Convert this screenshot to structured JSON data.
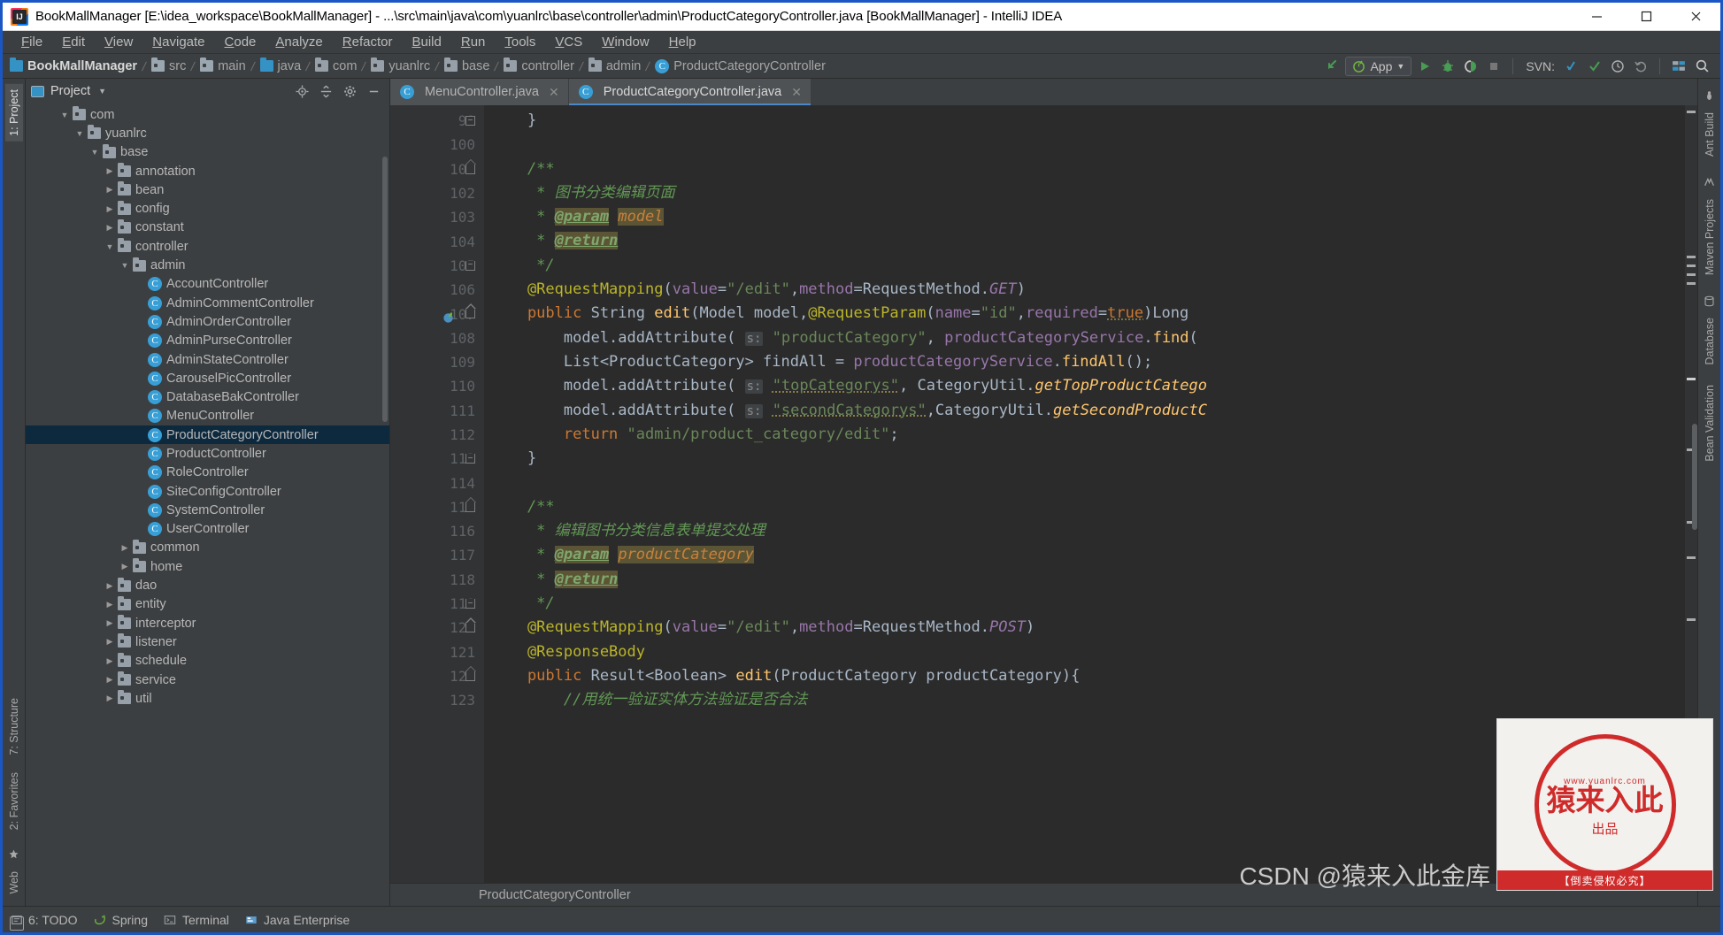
{
  "window": {
    "title": "BookMallManager [E:\\idea_workspace\\BookMallManager] - ...\\src\\main\\java\\com\\yuanlrc\\base\\controller\\admin\\ProductCategoryController.java [BookMallManager] - IntelliJ IDEA",
    "app_icon": "intellij-idea-icon",
    "minimize": "—",
    "maximize": "□",
    "close": "✕"
  },
  "menubar": [
    {
      "label": "File"
    },
    {
      "label": "Edit"
    },
    {
      "label": "View"
    },
    {
      "label": "Navigate"
    },
    {
      "label": "Code"
    },
    {
      "label": "Analyze"
    },
    {
      "label": "Refactor"
    },
    {
      "label": "Build"
    },
    {
      "label": "Run"
    },
    {
      "label": "Tools"
    },
    {
      "label": "VCS"
    },
    {
      "label": "Window"
    },
    {
      "label": "Help"
    }
  ],
  "breadcrumb": [
    {
      "label": "BookMallManager",
      "icon": "module-icon"
    },
    {
      "label": "src",
      "icon": "folder-icon"
    },
    {
      "label": "main",
      "icon": "folder-icon"
    },
    {
      "label": "java",
      "icon": "source-folder-icon"
    },
    {
      "label": "com",
      "icon": "package-icon"
    },
    {
      "label": "yuanlrc",
      "icon": "package-icon"
    },
    {
      "label": "base",
      "icon": "package-icon"
    },
    {
      "label": "controller",
      "icon": "package-icon"
    },
    {
      "label": "admin",
      "icon": "package-icon"
    },
    {
      "label": "ProductCategoryController",
      "icon": "class-icon"
    }
  ],
  "toolbar": {
    "run_config": "App",
    "run_config_icon": "spring-boot-icon",
    "back_icon": "navigate-back-icon",
    "run_icon": "run-icon",
    "debug_icon": "debug-icon",
    "coverage_icon": "run-with-coverage-icon",
    "stop_icon": "stop-icon",
    "svn_label": "SVN:",
    "svn_update_icon": "vcs-update-icon",
    "svn_commit_icon": "vcs-commit-icon",
    "svn_history_icon": "vcs-history-icon",
    "svn_rollback_icon": "vcs-rollback-icon",
    "settings_icon": "project-structure-icon",
    "search_icon": "search-everywhere-icon"
  },
  "left_rail": {
    "tabs": [
      {
        "label": "1: Project",
        "active": true
      },
      {
        "label": "7: Structure",
        "active": false
      },
      {
        "label": "2: Favorites",
        "active": false
      },
      {
        "label": "Web",
        "active": false
      }
    ],
    "icons": [
      "bookmark-star-icon",
      "database-icon"
    ]
  },
  "right_rail": {
    "tabs": [
      {
        "label": "Ant Build"
      },
      {
        "label": "Maven Projects"
      },
      {
        "label": "Database"
      },
      {
        "label": "Bean Validation"
      }
    ]
  },
  "project_panel": {
    "title": "Project",
    "title_icon": "project-view-icon",
    "caret_icon": "chevron-down-icon",
    "actions": [
      "locate-icon",
      "collapse-all-icon",
      "settings-gear-icon",
      "hide-icon"
    ],
    "tree": [
      {
        "label": "com",
        "indent": 2,
        "arrow": "down",
        "icon": "package-icon",
        "selected": false
      },
      {
        "label": "yuanlrc",
        "indent": 3,
        "arrow": "down",
        "icon": "package-icon",
        "selected": false
      },
      {
        "label": "base",
        "indent": 4,
        "arrow": "down",
        "icon": "package-icon",
        "selected": false
      },
      {
        "label": "annotation",
        "indent": 5,
        "arrow": "right",
        "icon": "package-icon",
        "selected": false
      },
      {
        "label": "bean",
        "indent": 5,
        "arrow": "right",
        "icon": "package-icon",
        "selected": false
      },
      {
        "label": "config",
        "indent": 5,
        "arrow": "right",
        "icon": "package-icon",
        "selected": false
      },
      {
        "label": "constant",
        "indent": 5,
        "arrow": "right",
        "icon": "package-icon",
        "selected": false
      },
      {
        "label": "controller",
        "indent": 5,
        "arrow": "down",
        "icon": "package-icon",
        "selected": false
      },
      {
        "label": "admin",
        "indent": 6,
        "arrow": "down",
        "icon": "package-icon",
        "selected": false
      },
      {
        "label": "AccountController",
        "indent": 7,
        "arrow": "none",
        "icon": "class-icon",
        "selected": false
      },
      {
        "label": "AdminCommentController",
        "indent": 7,
        "arrow": "none",
        "icon": "class-icon",
        "selected": false
      },
      {
        "label": "AdminOrderController",
        "indent": 7,
        "arrow": "none",
        "icon": "class-icon",
        "selected": false
      },
      {
        "label": "AdminPurseController",
        "indent": 7,
        "arrow": "none",
        "icon": "class-icon",
        "selected": false
      },
      {
        "label": "AdminStateController",
        "indent": 7,
        "arrow": "none",
        "icon": "class-icon",
        "selected": false
      },
      {
        "label": "CarouselPicController",
        "indent": 7,
        "arrow": "none",
        "icon": "class-icon",
        "selected": false
      },
      {
        "label": "DatabaseBakController",
        "indent": 7,
        "arrow": "none",
        "icon": "class-icon",
        "selected": false
      },
      {
        "label": "MenuController",
        "indent": 7,
        "arrow": "none",
        "icon": "class-icon",
        "selected": false
      },
      {
        "label": "ProductCategoryController",
        "indent": 7,
        "arrow": "none",
        "icon": "class-icon",
        "selected": true
      },
      {
        "label": "ProductController",
        "indent": 7,
        "arrow": "none",
        "icon": "class-icon",
        "selected": false
      },
      {
        "label": "RoleController",
        "indent": 7,
        "arrow": "none",
        "icon": "class-icon",
        "selected": false
      },
      {
        "label": "SiteConfigController",
        "indent": 7,
        "arrow": "none",
        "icon": "class-icon",
        "selected": false
      },
      {
        "label": "SystemController",
        "indent": 7,
        "arrow": "none",
        "icon": "class-icon",
        "selected": false
      },
      {
        "label": "UserController",
        "indent": 7,
        "arrow": "none",
        "icon": "class-icon",
        "selected": false
      },
      {
        "label": "common",
        "indent": 6,
        "arrow": "right",
        "icon": "package-icon",
        "selected": false
      },
      {
        "label": "home",
        "indent": 6,
        "arrow": "right",
        "icon": "package-icon",
        "selected": false
      },
      {
        "label": "dao",
        "indent": 5,
        "arrow": "right",
        "icon": "package-icon",
        "selected": false
      },
      {
        "label": "entity",
        "indent": 5,
        "arrow": "right",
        "icon": "package-icon",
        "selected": false
      },
      {
        "label": "interceptor",
        "indent": 5,
        "arrow": "right",
        "icon": "package-icon",
        "selected": false
      },
      {
        "label": "listener",
        "indent": 5,
        "arrow": "right",
        "icon": "package-icon",
        "selected": false
      },
      {
        "label": "schedule",
        "indent": 5,
        "arrow": "right",
        "icon": "package-icon",
        "selected": false
      },
      {
        "label": "service",
        "indent": 5,
        "arrow": "right",
        "icon": "package-icon",
        "selected": false
      },
      {
        "label": "util",
        "indent": 5,
        "arrow": "right",
        "icon": "package-icon",
        "selected": false
      }
    ]
  },
  "editor": {
    "tabs": [
      {
        "label": "MenuController.java",
        "icon": "class-icon",
        "active": false,
        "closeable": true
      },
      {
        "label": "ProductCategoryController.java",
        "icon": "class-icon",
        "active": true,
        "closeable": true
      }
    ],
    "breadcrumb": "ProductCategoryController",
    "first_line": 99,
    "line_numbers": [
      99,
      100,
      101,
      102,
      103,
      104,
      105,
      106,
      107,
      108,
      109,
      110,
      111,
      112,
      113,
      114,
      115,
      116,
      117,
      118,
      119,
      120,
      121,
      122,
      123
    ],
    "code_lines": [
      "}",
      "",
      "/**",
      " * 图书分类编辑页面",
      " * @param model",
      " * @return",
      " */",
      "@RequestMapping(value=\"/edit\",method=RequestMethod.GET)",
      "public String edit(Model model,@RequestParam(name=\"id\",required=true)Long",
      "    model.addAttribute( s: \"productCategory\", productCategoryService.find(",
      "    List<ProductCategory> findAll = productCategoryService.findAll();",
      "    model.addAttribute( s: \"topCategorys\", CategoryUtil.getTopProductCatego",
      "    model.addAttribute( s: \"secondCategorys\",CategoryUtil.getSecondProductC",
      "    return \"admin/product_category/edit\";",
      "}",
      "",
      "/**",
      " * 编辑图书分类信息表单提交处理",
      " * @param productCategory",
      " * @return",
      " */",
      "@RequestMapping(value=\"/edit\",method=RequestMethod.POST)",
      "@ResponseBody",
      "public Result<Boolean> edit(ProductCategory productCategory){",
      "    //用统一验证实体方法验证是否合法"
    ],
    "gutter_icons": {
      "line_107": "spring-bean-icon"
    }
  },
  "statusbar": {
    "items": [
      {
        "label": "6: TODO",
        "icon": "todo-icon"
      },
      {
        "label": "Spring",
        "icon": "spring-icon"
      },
      {
        "label": "Terminal",
        "icon": "terminal-icon"
      },
      {
        "label": "Java Enterprise",
        "icon": "java-enterprise-icon"
      }
    ]
  },
  "watermark": {
    "stamp_top": "www.yuanlrc.com",
    "stamp_main": "猿来入此",
    "stamp_sub": "出品",
    "stamp_foot": "【倒卖侵权必究】",
    "csdn_text": "CSDN @猿来入此金库"
  },
  "colors": {
    "accent": "#4a88c7",
    "selection": "#0d293e",
    "editor_bg": "#2b2b2b",
    "panel_bg": "#3c3f41",
    "gutter_bg": "#313335",
    "class_icon": "#389fd6",
    "stamp_red": "#cf2b2b"
  }
}
